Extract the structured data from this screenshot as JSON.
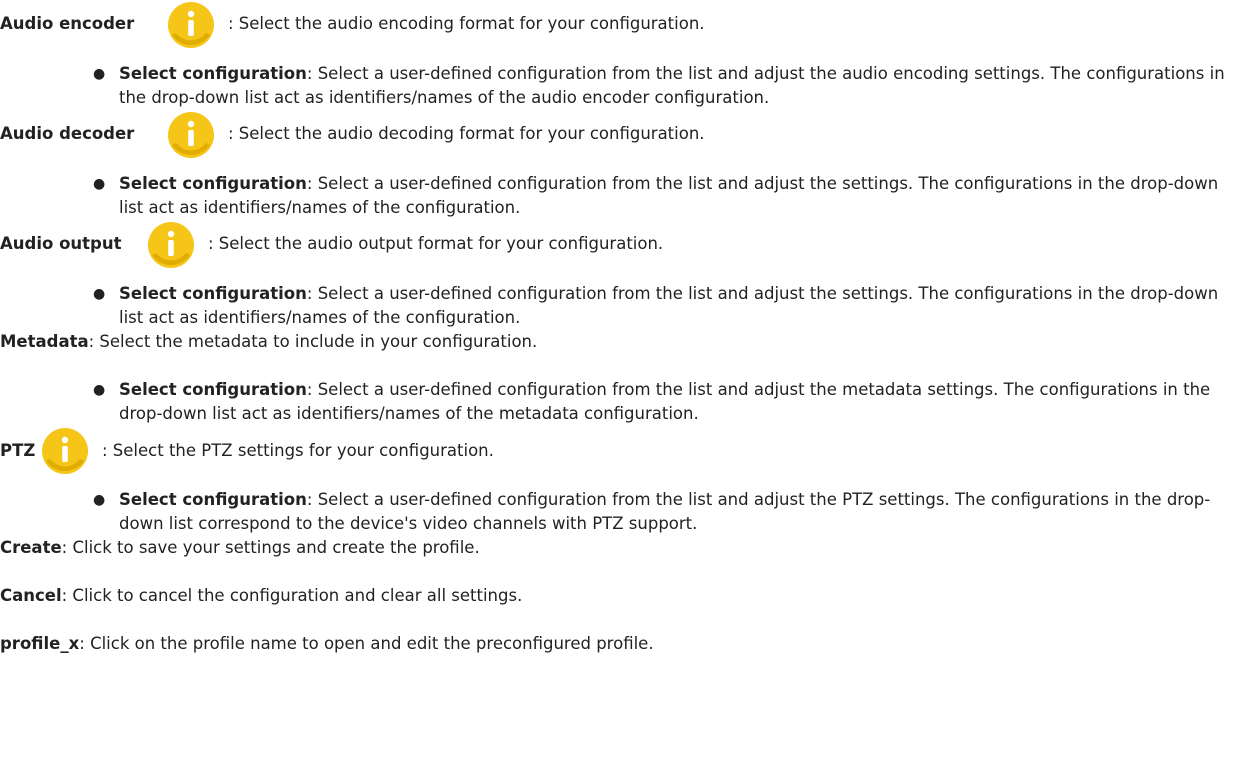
{
  "sections": [
    {
      "term": "Audio encoder",
      "desc": ": Select the audio encoding format for your configuration.",
      "has_icon": true,
      "bullet_term": "Select configuration",
      "bullet_desc": ": Select a user-defined configuration from the list and adjust the audio encoding settings. The configurations in the drop-down list act as identifiers/names of the audio encoder configuration."
    },
    {
      "term": "Audio decoder",
      "desc": ": Select the audio decoding format for your configuration.",
      "has_icon": true,
      "bullet_term": "Select configuration",
      "bullet_desc": ": Select a user-defined configuration from the list and adjust the settings. The configurations in the drop-down list act as identifiers/names of the configuration."
    },
    {
      "term": "Audio output",
      "desc": ": Select the audio output format for your configuration.",
      "has_icon": true,
      "bullet_term": "Select configuration",
      "bullet_desc": ": Select a user-defined configuration from the list and adjust the settings. The configurations in the drop-down list act as identifiers/names of the configuration."
    },
    {
      "term": "Metadata",
      "desc": ": Select the metadata to include in your configuration.",
      "has_icon": false,
      "bullet_term": "Select configuration",
      "bullet_desc": ": Select a user-defined configuration from the list and adjust the metadata settings. The configurations in the drop-down list act as identifiers/names of the metadata configuration."
    },
    {
      "term": "PTZ",
      "desc": ": Select the PTZ settings for your configuration.",
      "has_icon": true,
      "bullet_term": "Select configuration",
      "bullet_desc": ": Select a user-defined configuration from the list and adjust the PTZ settings. The configurations in the drop-down list correspond to the device's video channels with PTZ support."
    }
  ],
  "trailing": [
    {
      "term": "Create",
      "desc": ": Click to save your settings and create the profile."
    },
    {
      "term": "Cancel",
      "desc": ": Click to cancel the configuration and clear all settings."
    },
    {
      "term": "profile_x",
      "desc": ": Click on the profile name to open and edit the preconfigured profile."
    }
  ],
  "icon": {
    "name": "info-icon",
    "color": "#f5c518",
    "glyph": "i"
  }
}
